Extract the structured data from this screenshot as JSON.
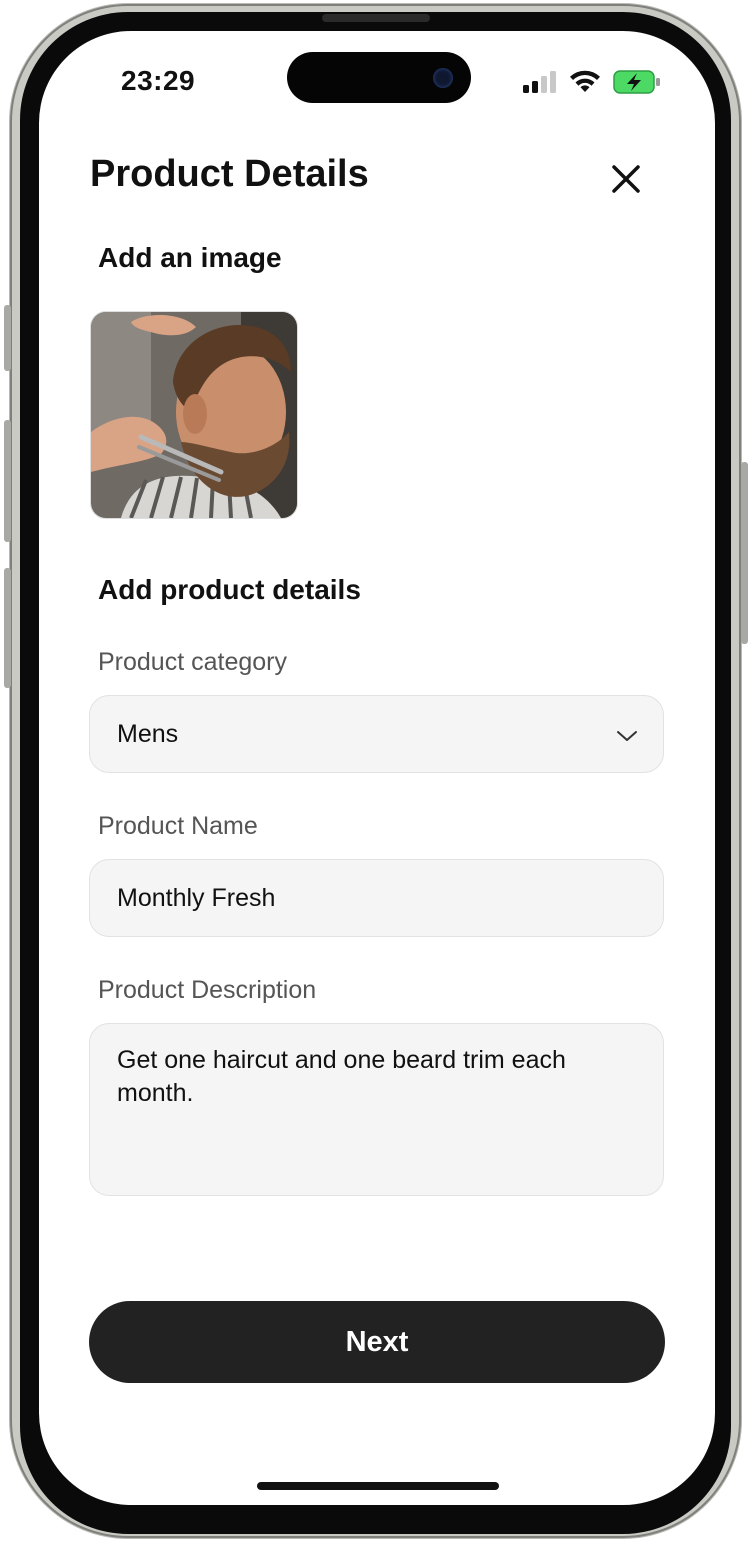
{
  "status": {
    "time": "23:29"
  },
  "header": {
    "title": "Product Details"
  },
  "image_section": {
    "heading": "Add an image"
  },
  "details_section": {
    "heading": "Add product details",
    "category": {
      "label": "Product category",
      "value": "Mens"
    },
    "name": {
      "label": "Product Name",
      "value": "Monthly Fresh"
    },
    "description": {
      "label": "Product Description",
      "value": "Get one haircut and one beard trim each month."
    }
  },
  "actions": {
    "next_label": "Next"
  },
  "colors": {
    "button": "#222222",
    "field_bg": "#f5f5f5",
    "battery": "#4cd964"
  }
}
